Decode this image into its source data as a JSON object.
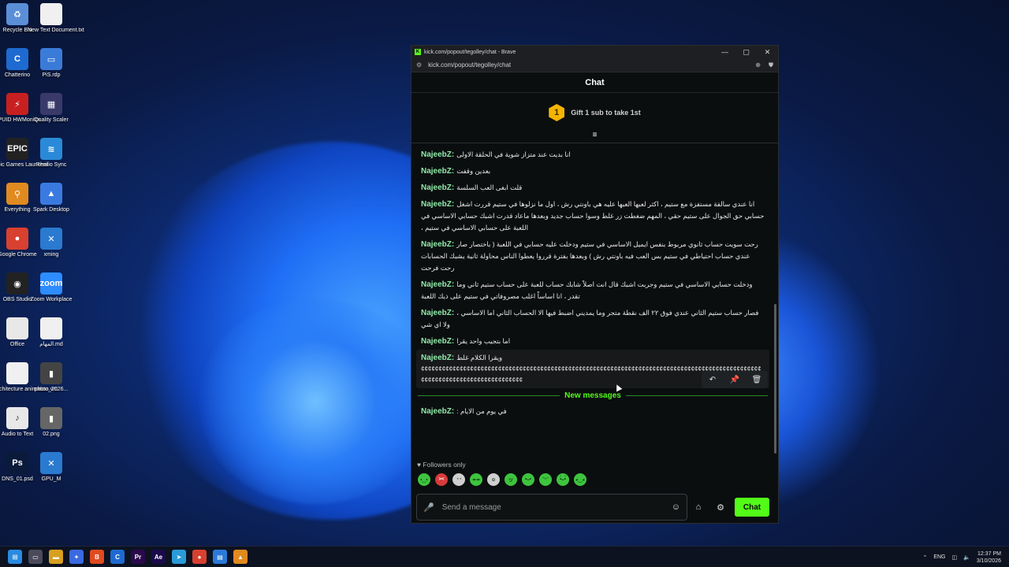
{
  "desktop": {
    "icons": [
      {
        "label": "Recycle Bin",
        "glyph": "♻",
        "color": "#5a8fd8"
      },
      {
        "label": "New Text Document.txt",
        "glyph": "",
        "color": "#f0f0f0"
      },
      {
        "label": "Chatterino",
        "glyph": "C",
        "color": "#1e6ad0"
      },
      {
        "label": "PiS.rdp",
        "glyph": "▭",
        "color": "#3b7bd8"
      },
      {
        "label": "CPUID HWMonitor",
        "glyph": "⚡",
        "color": "#c82020"
      },
      {
        "label": "Quality Scaler",
        "glyph": "▦",
        "color": "#3a3a6a"
      },
      {
        "label": "Epic Games Launcher",
        "glyph": "EPIC",
        "color": "#222"
      },
      {
        "label": "Resilio Sync",
        "glyph": "≋",
        "color": "#2a8ad8"
      },
      {
        "label": "Everything",
        "glyph": "⚲",
        "color": "#e08a20"
      },
      {
        "label": "Spark Desktop",
        "glyph": "▲",
        "color": "#3a7ae0"
      },
      {
        "label": "Google Chrome",
        "glyph": "●",
        "color": "#d84030"
      },
      {
        "label": "xming",
        "glyph": "✕",
        "color": "#2a7ad0"
      },
      {
        "label": "OBS Studio",
        "glyph": "◉",
        "color": "#222"
      },
      {
        "label": "Zoom Workplace",
        "glyph": "zoom",
        "color": "#2d8cff"
      },
      {
        "label": "Office",
        "glyph": "",
        "color": "#e8e8e8"
      },
      {
        "label": "المهام.md",
        "glyph": "",
        "color": "#f0f0f0"
      },
      {
        "label": "Architecture animation.vm",
        "glyph": "",
        "color": "#f0f0f0"
      },
      {
        "label": "photo_2026...",
        "glyph": "▮",
        "color": "#444"
      },
      {
        "label": "Audio to Text",
        "glyph": "♪",
        "color": "#e8e8e8"
      },
      {
        "label": "02.png",
        "glyph": "▮",
        "color": "#666"
      },
      {
        "label": "DNS_01.psd",
        "glyph": "Ps",
        "color": "#0a1a3a"
      },
      {
        "label": "GPU_M",
        "glyph": "✕",
        "color": "#2a7ad0"
      }
    ]
  },
  "browser": {
    "title": "kick.com/popout/tegolley/chat - Brave",
    "url": "kick.com/popout/tegolley/chat",
    "favicon": "K",
    "accent": "#53fc18"
  },
  "chat": {
    "header": "Chat",
    "gift_rank": "1",
    "gift_text": "Gift 1 sub to take 1st",
    "messages": [
      {
        "user": "NajeebZ:",
        "text": "انا بديت عند متزاز شوية في الحلقة الاولى"
      },
      {
        "user": "NajeebZ:",
        "text": "بعدين وقفت"
      },
      {
        "user": "NajeebZ:",
        "text": "قلت ابغى العب السلسة"
      },
      {
        "user": "NajeebZ:",
        "text": "انا عندي سالفة مستفزة مع ستيم ، اكثر لعبها العبها عليه هي باونتي رش ، اول ما نزلوها في ستيم قررت اشغل حسابي حق الجوال على ستيم حقي ، المهم ضغطت زر غلط وسوا حساب جديد وبعدها ماعاد قدرت اشبك حسابي الاساسي في اللعبة على حسابي الاساسي في ستيم ،"
      },
      {
        "user": "NajeebZ:",
        "text": "رحت سويت حساب ثانوي مربوط بنفس ايميل الاساسي في ستيم ودخلت عليه حسابي في اللعبة ( باختصار صار عندي حساب احتياطي في ستيم بس العب فيه باونتي رش ) وبعدها بفترة قرروا يعطوا الناس محاولة ثانية يشبك الحسابات رحت فرحت"
      },
      {
        "user": "NajeebZ:",
        "text": "ودخلت حسابي الاساسي في ستيم وجربت اشبك قال انت اصلاً شابك حساب للعبة على حساب ستيم ثاني وما تقدر ، انا اساساً اغلب مصروفاتي في ستيم على ذيك اللعبة"
      },
      {
        "user": "NajeebZ:",
        "text": "فصار حساب ستيم الثاني عندي فوق ٢٢ الف نقطة متجر وما يمديني اضبط فيها الا الحساب الثاني اما الاساسي ، ولا اي شي"
      },
      {
        "user": "NajeebZ:",
        "text": "اما بتجيب واحد يقرا"
      },
      {
        "user": "NajeebZ:",
        "text": "ويقرا الكلام غلط"
      }
    ],
    "spam_line": "¢¢¢¢¢¢¢¢¢¢¢¢¢¢¢¢¢¢¢¢¢¢¢¢¢¢¢¢¢¢¢¢¢¢¢¢¢¢¢¢¢¢¢¢¢¢¢¢¢¢¢¢¢¢¢¢¢¢¢¢¢¢¢¢¢¢¢¢¢¢¢¢¢¢¢¢¢¢¢¢¢¢¢¢¢¢¢¢¢¢¢¢¢¢¢¢¢¢¢¢¢¢¢¢¢¢¢¢¢¢¢¢¢¢¢¢¢¢¢¢¢¢¢¢¢¢",
    "new_messages_label": "New messages",
    "new_message": {
      "user": "NajeebZ:",
      "text": "في يوم من الايام :"
    },
    "followers_only": "Followers only",
    "input_placeholder": "Send a message",
    "send_label": "Chat",
    "emotes": [
      "•‿•",
      "><",
      "◔◔",
      "≖≖",
      "⊙",
      "ツ",
      "•ᴗ•",
      "ᵔᵕᵔ",
      "•̀ᴗ•́",
      "◕‿◕"
    ]
  },
  "taskbar": {
    "apps": [
      {
        "glyph": "⊞",
        "color": "#2a8ae0"
      },
      {
        "glyph": "▭",
        "color": "#4a4a5a"
      },
      {
        "glyph": "▬",
        "color": "#d8a020"
      },
      {
        "glyph": "✦",
        "color": "#3a6ae0"
      },
      {
        "glyph": "B",
        "color": "#e04a20"
      },
      {
        "glyph": "C",
        "color": "#1e6ad0"
      },
      {
        "glyph": "Pr",
        "color": "#2a0a4a"
      },
      {
        "glyph": "Ae",
        "color": "#1a0a4a"
      },
      {
        "glyph": "➤",
        "color": "#2a9ad8"
      },
      {
        "glyph": "●",
        "color": "#d84030"
      },
      {
        "glyph": "▤",
        "color": "#2a7ad8"
      },
      {
        "glyph": "▲",
        "color": "#e08a20"
      }
    ],
    "lang": "ENG",
    "time": "12:37 PM",
    "date": "3/10/2026"
  }
}
